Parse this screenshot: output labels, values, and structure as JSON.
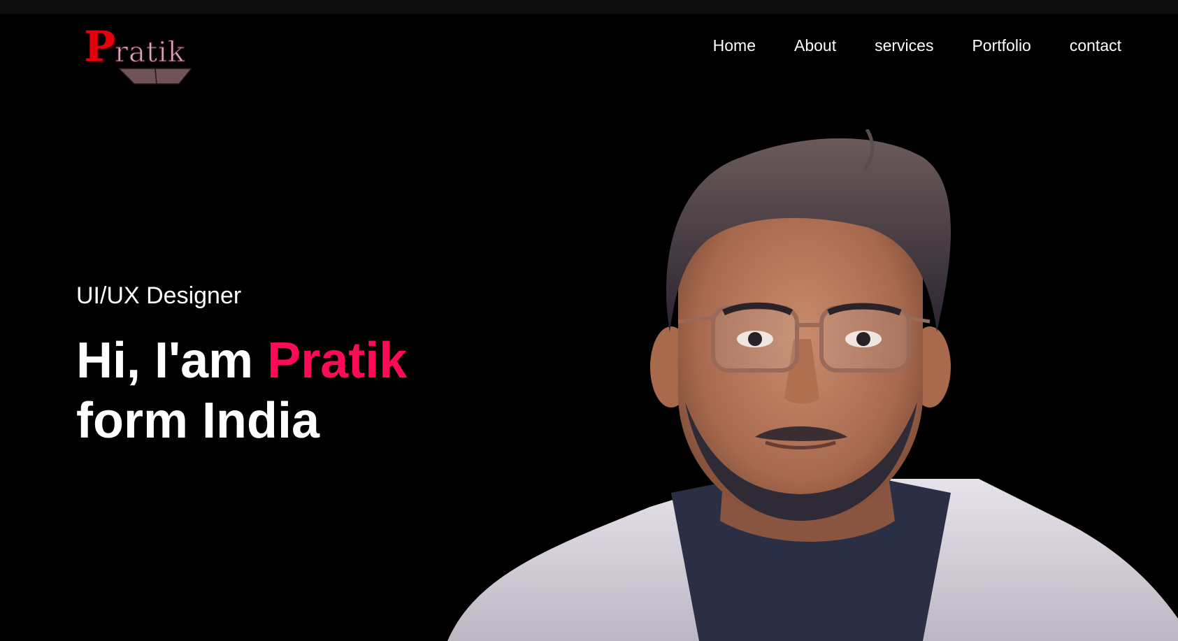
{
  "logo": {
    "first_letter": "P",
    "rest": "ratik",
    "primary_color": "#e3000f",
    "secondary_color": "#d9aeb8"
  },
  "nav": {
    "items": [
      {
        "label": "Home"
      },
      {
        "label": "About"
      },
      {
        "label": "services"
      },
      {
        "label": "Portfolio"
      },
      {
        "label": "contact"
      }
    ]
  },
  "hero": {
    "subtitle": "UI/UX Designer",
    "greeting": "Hi, I'am",
    "name": "Pratik",
    "line2": "form India",
    "accent_color": "#ff0a57"
  },
  "portrait": {
    "icon": "profile-photo"
  }
}
